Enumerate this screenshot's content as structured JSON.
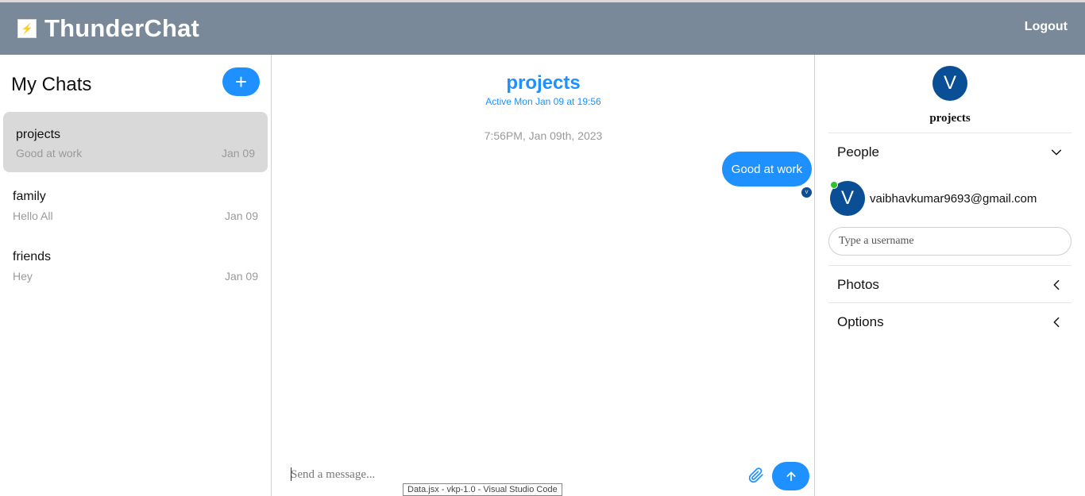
{
  "app": {
    "brand": "ThunderChat",
    "logout_label": "Logout"
  },
  "sidebar": {
    "title": "My Chats",
    "add_label": "+",
    "chats": [
      {
        "name": "projects",
        "preview": "Good at work",
        "date": "Jan 09",
        "active": true
      },
      {
        "name": "family",
        "preview": "Hello All",
        "date": "Jan 09",
        "active": false
      },
      {
        "name": "friends",
        "preview": "Hey",
        "date": "Jan 09",
        "active": false
      }
    ]
  },
  "conversation": {
    "title": "projects",
    "status": "Active Mon Jan 09 at 19:56",
    "timestamp_divider": "7:56PM, Jan 09th, 2023",
    "messages": [
      {
        "text": "Good at work",
        "read_avatar": "V"
      }
    ],
    "composer_placeholder": "Send a message...",
    "tooltip": "Data.jsx - vkp-1.0 - Visual Studio Code"
  },
  "details": {
    "avatar_letter": "V",
    "chat_name": "projects",
    "sections": {
      "people": "People",
      "photos": "Photos",
      "options": "Options"
    },
    "members": [
      {
        "avatar_letter": "V",
        "email": "vaibhavkumar9693@gmail.com",
        "online": true
      }
    ],
    "add_user_placeholder": "Type a username"
  },
  "colors": {
    "navbar": "#7a8999",
    "accent": "#1e90ff",
    "avatar": "#0a4f95",
    "online": "#2fc12f"
  }
}
